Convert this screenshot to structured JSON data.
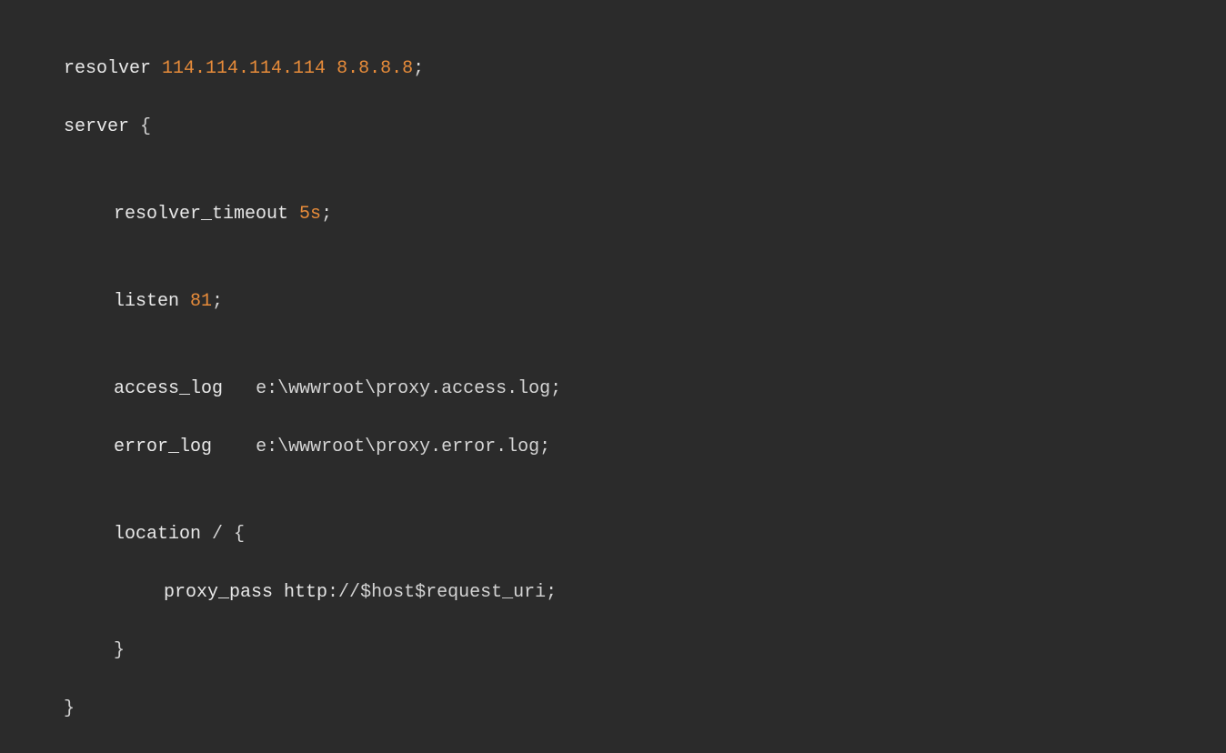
{
  "code": {
    "line1": {
      "keyword": "resolver",
      "value": "114.114.114.114 8.8.8.8",
      "end": ";"
    },
    "line2": {
      "keyword": "server",
      "brace": " {"
    },
    "line3": {
      "keyword": "resolver_timeout",
      "value": "5s",
      "end": ";"
    },
    "line4": {
      "keyword": "listen",
      "value": "81",
      "end": ";"
    },
    "line5": {
      "keyword": "access_log",
      "spacer": "  ",
      "path": "e:\\wwwroot\\proxy.access.log",
      "end": ";"
    },
    "line6": {
      "keyword": "error_log",
      "spacer": "   ",
      "path": "e:\\wwwroot\\proxy.error.log",
      "end": ";"
    },
    "line7": {
      "keyword": "location",
      "path": " / ",
      "brace": "{"
    },
    "line8": {
      "keyword": "proxy_pass",
      "scheme": " http",
      "sep": "://",
      "var1": "$host",
      "var2": "$request_uri",
      "end": ";"
    },
    "line9": {
      "brace": "}"
    },
    "line10": {
      "brace": "}"
    }
  }
}
